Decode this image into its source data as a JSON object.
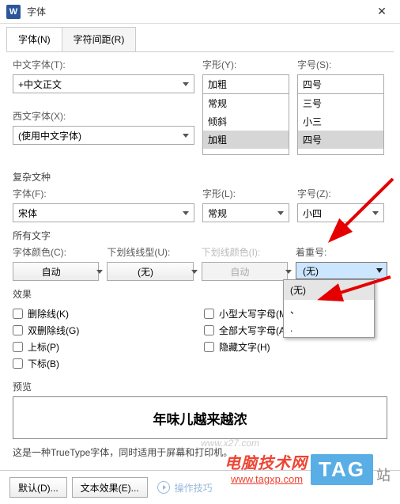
{
  "title": "字体",
  "tabs": {
    "font": "字体(N)",
    "spacing": "字符间距(R)"
  },
  "labels": {
    "cnFont": "中文字体(T):",
    "westFont": "西文字体(X):",
    "style": "字形(Y):",
    "size": "字号(S):",
    "complex": "复杂文种",
    "fontF": "字体(F):",
    "styleL": "字形(L):",
    "sizeZ": "字号(Z):",
    "allText": "所有文字",
    "fontColor": "字体颜色(C):",
    "ulStyle": "下划线线型(U):",
    "ulColor": "下划线颜色(I):",
    "emphasis": "着重号:",
    "effects": "效果",
    "preview": "预览"
  },
  "values": {
    "cnFont": "+中文正文",
    "westFont": "(使用中文字体)",
    "style": "加粗",
    "size": "四号",
    "fontF": "宋体",
    "styleL": "常规",
    "sizeZ": "小四",
    "fontColor": "自动",
    "ulStyle": "(无)",
    "ulColor": "自动",
    "emphasis": "(无)"
  },
  "styleOptions": [
    "常规",
    "倾斜",
    "加粗"
  ],
  "sizeOptions": [
    "三号",
    "小三",
    "四号"
  ],
  "emphOptions": [
    "(无)",
    "、",
    "."
  ],
  "checks": {
    "strike": "删除线(K)",
    "dstrike": "双删除线(G)",
    "sup": "上标(P)",
    "sub": "下标(B)",
    "smallcaps": "小型大写字母(M)",
    "allcaps": "全部大写字母(A)",
    "hidden": "隐藏文字(H)"
  },
  "previewText": "年味儿越来越浓",
  "note": "这是一种TrueType字体，同时适用于屏幕和打印机。",
  "footer": {
    "default": "默认(D)...",
    "textFx": "文本效果(E)...",
    "hint": "操作技巧"
  },
  "watermark": "www.x27.com",
  "overlay": {
    "brand": "电脑技术网",
    "url": "www.tagxp.com",
    "tag": "TAG",
    "suffix": "站"
  }
}
